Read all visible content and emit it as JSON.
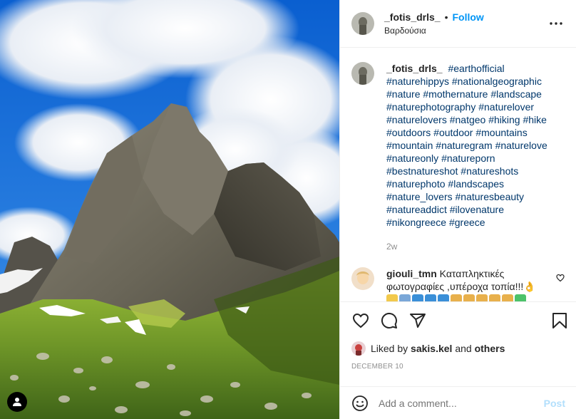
{
  "header": {
    "username": "_fotis_drls_",
    "separator": "•",
    "follow_label": "Follow",
    "location": "Βαρδούσια"
  },
  "caption": {
    "username": "_fotis_drls_",
    "hashtags": [
      "#earthofficial",
      "#naturehippys",
      "#nationalgeographic",
      "#nature",
      "#mothernature",
      "#landscape",
      "#naturephotography",
      "#naturelover",
      "#naturelovers",
      "#natgeo",
      "#hiking",
      "#hike",
      "#outdoors",
      "#outdoor",
      "#mountains",
      "#mountain",
      "#naturegram",
      "#naturelove",
      "#natureonly",
      "#natureporn",
      "#bestnatureshot",
      "#natureshots",
      "#naturephoto",
      "#landscapes",
      "#nature_lovers",
      "#naturesbeauty",
      "#natureaddict",
      "#ilovenature",
      "#nikongreece",
      "#greece"
    ],
    "time": "2w"
  },
  "comment": {
    "username": "giouli_tmn",
    "text": "Καταπληκτικές φωτογραφίες ,υπέροχα τοπία!!!👌"
  },
  "likes": {
    "prefix": "Liked by",
    "user": "sakis.kel",
    "conjunction": "and",
    "others": "others"
  },
  "date": "DECEMBER 10",
  "add_comment": {
    "placeholder": "Add a comment...",
    "post_label": "Post"
  },
  "colors": {
    "accent": "#0095f6",
    "hashtag": "#00376b",
    "muted": "#8e8e8e",
    "post_disabled": "#b2dffc"
  },
  "icons": [
    "user-tag-icon",
    "more-options-icon",
    "heart-icon",
    "comment-icon",
    "share-icon",
    "bookmark-icon",
    "emoji-icon"
  ]
}
